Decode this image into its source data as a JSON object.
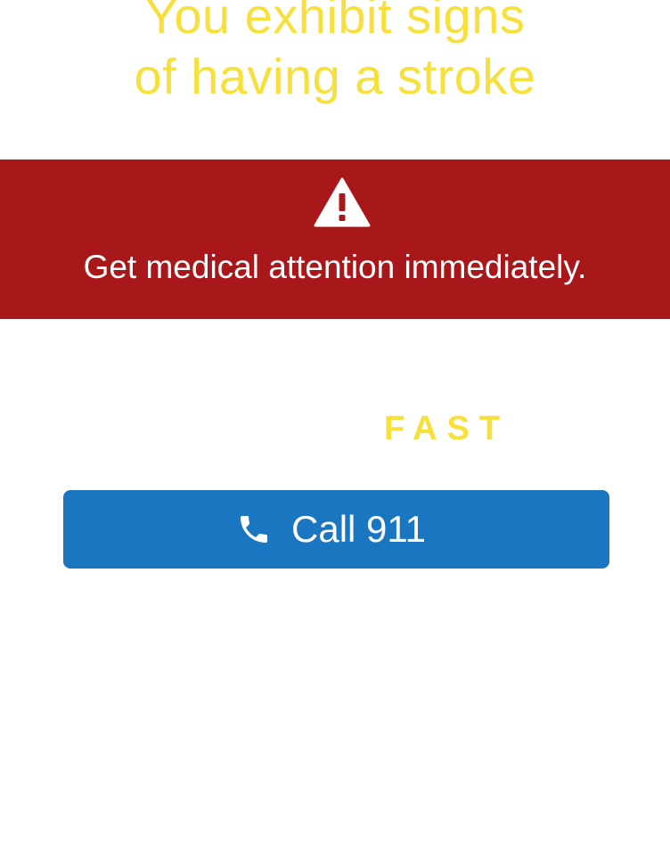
{
  "headline": {
    "line1": "You exhibit signs",
    "line2": "of having a stroke"
  },
  "alert": {
    "icon": "warning-triangle-icon",
    "message": "Get medical attention immediately."
  },
  "fast_label": "FAST",
  "call_button": {
    "icon": "phone-icon",
    "label": "Call 911"
  },
  "colors": {
    "headline": "#f7e03c",
    "alert_background": "#a8181a",
    "button_background": "#1b76c1"
  }
}
